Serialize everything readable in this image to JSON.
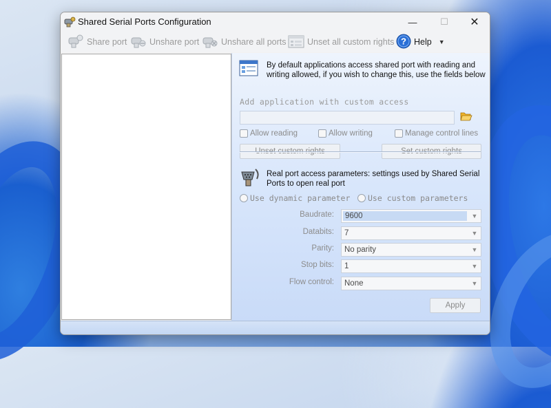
{
  "window": {
    "title": "Shared Serial Ports Configuration",
    "minimize_glyph": "—",
    "maximize_glyph": "☐",
    "close_glyph": "✕"
  },
  "toolbar": {
    "share_port": "Share port",
    "unshare_port": "Unshare port",
    "unshare_all_ports": "Unshare all ports",
    "unset_all_custom_rights": "Unset all custom rights",
    "help": "Help"
  },
  "access": {
    "info": "By default applications access shared port with reading and writing allowed, if you wish to change this, use the fields below",
    "add_app_heading": "Add application with custom access",
    "app_path_value": "",
    "allow_reading": "Allow reading",
    "allow_writing": "Allow writing",
    "manage_control_lines": "Manage control lines",
    "unset_custom_rights": "Unset custom rights",
    "set_custom_rights": "Set custom rights"
  },
  "realport": {
    "info": "Real port access parameters: settings used by Shared Serial Ports to open real port",
    "use_dynamic": "Use dynamic parameter",
    "use_custom": "Use custom parameters",
    "fields": [
      {
        "label": "Baudrate:",
        "value": "9600"
      },
      {
        "label": "Databits:",
        "value": "7"
      },
      {
        "label": "Parity:",
        "value": "No parity"
      },
      {
        "label": "Stop bits:",
        "value": "1"
      },
      {
        "label": "Flow control:",
        "value": "None"
      }
    ],
    "apply": "Apply"
  },
  "colors": {
    "pane_gradient_top": "#eef4fd",
    "pane_gradient_bottom": "#c9dbf8",
    "help_icon": "#2a6fd6",
    "folder_icon": "#f0b429"
  },
  "icons": [
    "app-icon",
    "share-port-icon",
    "unshare-port-icon",
    "unshare-all-ports-icon",
    "unset-rights-icon",
    "help-icon",
    "app-window-icon",
    "folder-open-icon",
    "serial-connector-icon"
  ]
}
